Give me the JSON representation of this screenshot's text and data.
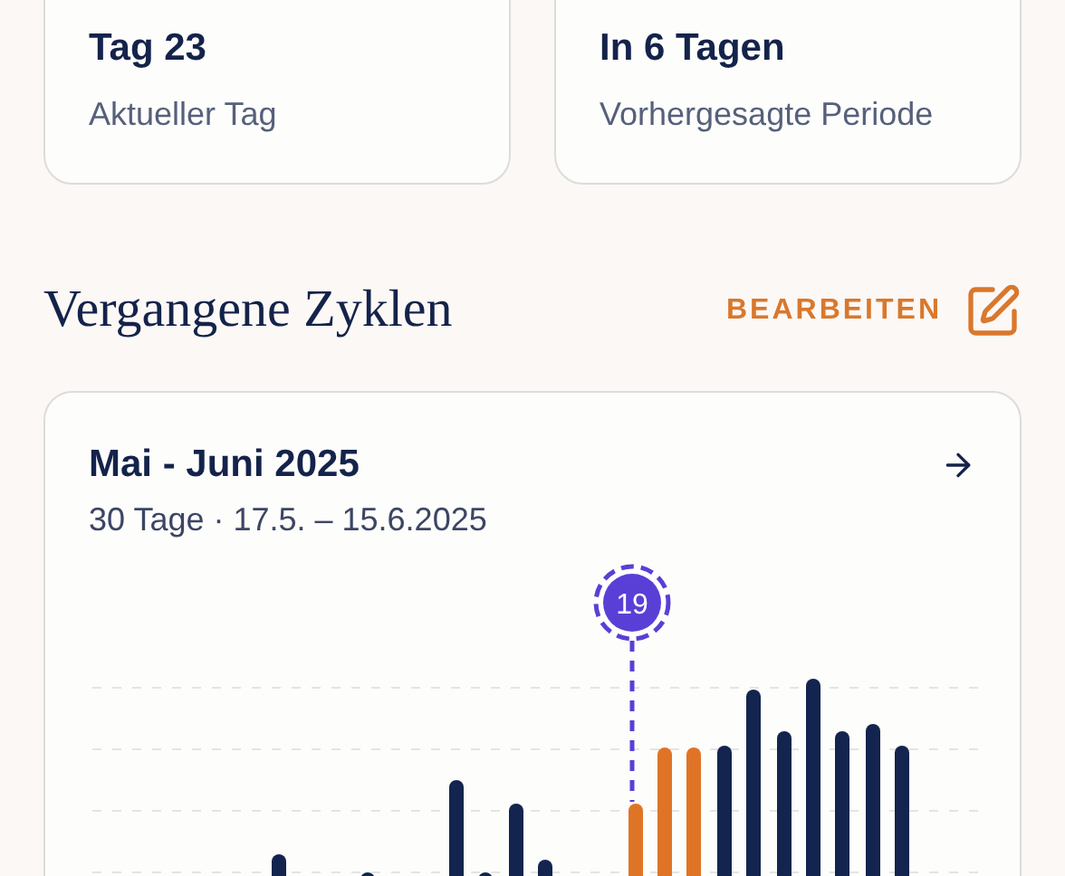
{
  "stats": [
    {
      "value": "Tag 23",
      "label": "Aktueller Tag"
    },
    {
      "value": "In 6 Tagen",
      "label": "Vorhergesagte Periode"
    }
  ],
  "section": {
    "title": "Vergangene Zyklen",
    "action": "BEARBEITEN"
  },
  "cycle": {
    "title": "Mai - Juni 2025",
    "subtitle": "30 Tage · 17.5. – 15.6.2025",
    "marker": "19"
  }
}
